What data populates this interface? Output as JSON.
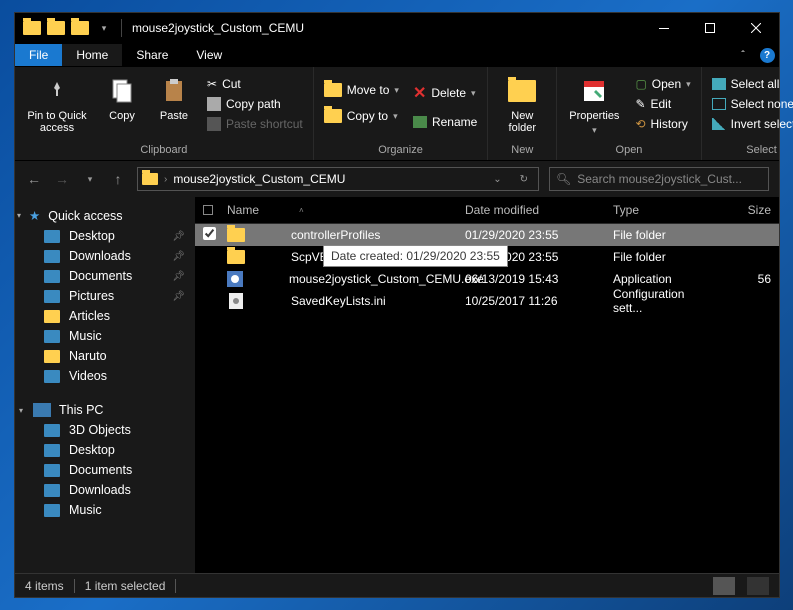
{
  "title": "mouse2joystick_Custom_CEMU",
  "tabs": {
    "file": "File",
    "home": "Home",
    "share": "Share",
    "view": "View"
  },
  "ribbon": {
    "pin": "Pin to Quick access",
    "copy": "Copy",
    "paste": "Paste",
    "cut": "Cut",
    "copypath": "Copy path",
    "pastesc": "Paste shortcut",
    "clipboard": "Clipboard",
    "moveto": "Move to",
    "copyto": "Copy to",
    "delete": "Delete",
    "rename": "Rename",
    "organize": "Organize",
    "newfolder": "New folder",
    "new": "New",
    "properties": "Properties",
    "open": "Open",
    "edit": "Edit",
    "history": "History",
    "open_g": "Open",
    "selall": "Select all",
    "selnone": "Select none",
    "invsel": "Invert selection",
    "select": "Select"
  },
  "address": "mouse2joystick_Custom_CEMU",
  "search_placeholder": "Search mouse2joystick_Cust...",
  "sidebar": {
    "quick": "Quick access",
    "items": [
      {
        "label": "Desktop",
        "pin": true,
        "ic": "desktop"
      },
      {
        "label": "Downloads",
        "pin": true,
        "ic": "down"
      },
      {
        "label": "Documents",
        "pin": true,
        "ic": "doc"
      },
      {
        "label": "Pictures",
        "pin": true,
        "ic": "pic"
      },
      {
        "label": "Articles",
        "pin": false,
        "ic": "folder"
      },
      {
        "label": "Music",
        "pin": false,
        "ic": "music"
      },
      {
        "label": "Naruto",
        "pin": false,
        "ic": "folder"
      },
      {
        "label": "Videos",
        "pin": false,
        "ic": "video"
      }
    ],
    "thispc": "This PC",
    "pc": [
      {
        "label": "3D Objects",
        "ic": "3d"
      },
      {
        "label": "Desktop",
        "ic": "desktop"
      },
      {
        "label": "Documents",
        "ic": "doc"
      },
      {
        "label": "Downloads",
        "ic": "down"
      },
      {
        "label": "Music",
        "ic": "music"
      }
    ]
  },
  "columns": {
    "name": "Name",
    "date": "Date modified",
    "type": "Type",
    "size": "Size"
  },
  "files": [
    {
      "name": "controllerProfiles",
      "date": "01/29/2020 23:55",
      "type": "File folder",
      "size": "",
      "ic": "folder",
      "sel": true
    },
    {
      "name": "ScpVBus",
      "date": "01/29/2020 23:55",
      "type": "File folder",
      "size": "",
      "ic": "folder",
      "sel": false
    },
    {
      "name": "mouse2joystick_Custom_CEMU.exe",
      "date": "06/13/2019 15:43",
      "type": "Application",
      "size": "56",
      "ic": "exe",
      "sel": false
    },
    {
      "name": "SavedKeyLists.ini",
      "date": "10/25/2017 11:26",
      "type": "Configuration sett...",
      "size": "",
      "ic": "ini",
      "sel": false
    }
  ],
  "tooltip": "Date created: 01/29/2020 23:55",
  "status": {
    "count": "4 items",
    "sel": "1 item selected"
  }
}
